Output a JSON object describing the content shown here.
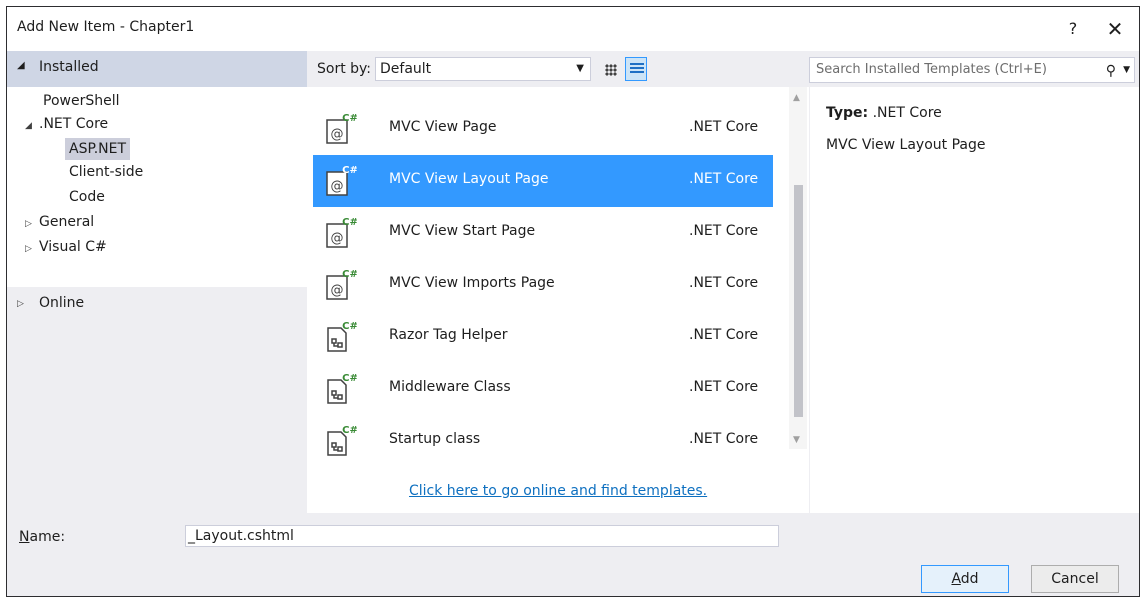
{
  "window": {
    "title": "Add New Item - Chapter1",
    "help_label": "?",
    "close_label": "✕"
  },
  "left_pane": {
    "installed_label": "Installed",
    "installed_toggle": "◢",
    "online_label": "Online",
    "online_toggle": "▷",
    "tree": [
      {
        "label": "PowerShell",
        "toggle": ""
      },
      {
        "label": ".NET Core",
        "toggle": "◢"
      },
      {
        "label": "ASP.NET",
        "toggle": ""
      },
      {
        "label": "Client-side",
        "toggle": ""
      },
      {
        "label": "Code",
        "toggle": ""
      },
      {
        "label": "General",
        "toggle": "▷"
      },
      {
        "label": "Visual C#",
        "toggle": "▷"
      }
    ],
    "selected_item": "ASP.NET"
  },
  "toolbar": {
    "sort_label": "Sort by:",
    "sort_value": "Default",
    "search_placeholder": "Search Installed Templates (Ctrl+E)"
  },
  "templates": [
    {
      "name": "MVC View Page",
      "category": ".NET Core",
      "icon": "mvc-view-icon"
    },
    {
      "name": "MVC View Layout Page",
      "category": ".NET Core",
      "icon": "mvc-view-icon"
    },
    {
      "name": "MVC View Start Page",
      "category": ".NET Core",
      "icon": "mvc-view-icon"
    },
    {
      "name": "MVC View Imports Page",
      "category": ".NET Core",
      "icon": "mvc-view-icon"
    },
    {
      "name": "Razor Tag Helper",
      "category": ".NET Core",
      "icon": "csharp-class-icon"
    },
    {
      "name": "Middleware Class",
      "category": ".NET Core",
      "icon": "csharp-class-icon"
    },
    {
      "name": "Startup class",
      "category": ".NET Core",
      "icon": "csharp-class-icon"
    }
  ],
  "selected_template": "MVC View Layout Page",
  "online_link": "Click here to go online and find templates.",
  "details": {
    "type_label": "Type:",
    "type_value": ".NET Core",
    "description": "MVC View Layout Page"
  },
  "name_field": {
    "label_accel": "N",
    "label_rest": "ame:",
    "value": "_Layout.cshtml"
  },
  "buttons": {
    "add_accel": "A",
    "add_rest": "dd",
    "cancel": "Cancel"
  },
  "colors": {
    "selection": "#3399ff",
    "link": "#0e70c0",
    "installed_header": "#cfd6e5",
    "dialog_background": "#eeeef2"
  }
}
